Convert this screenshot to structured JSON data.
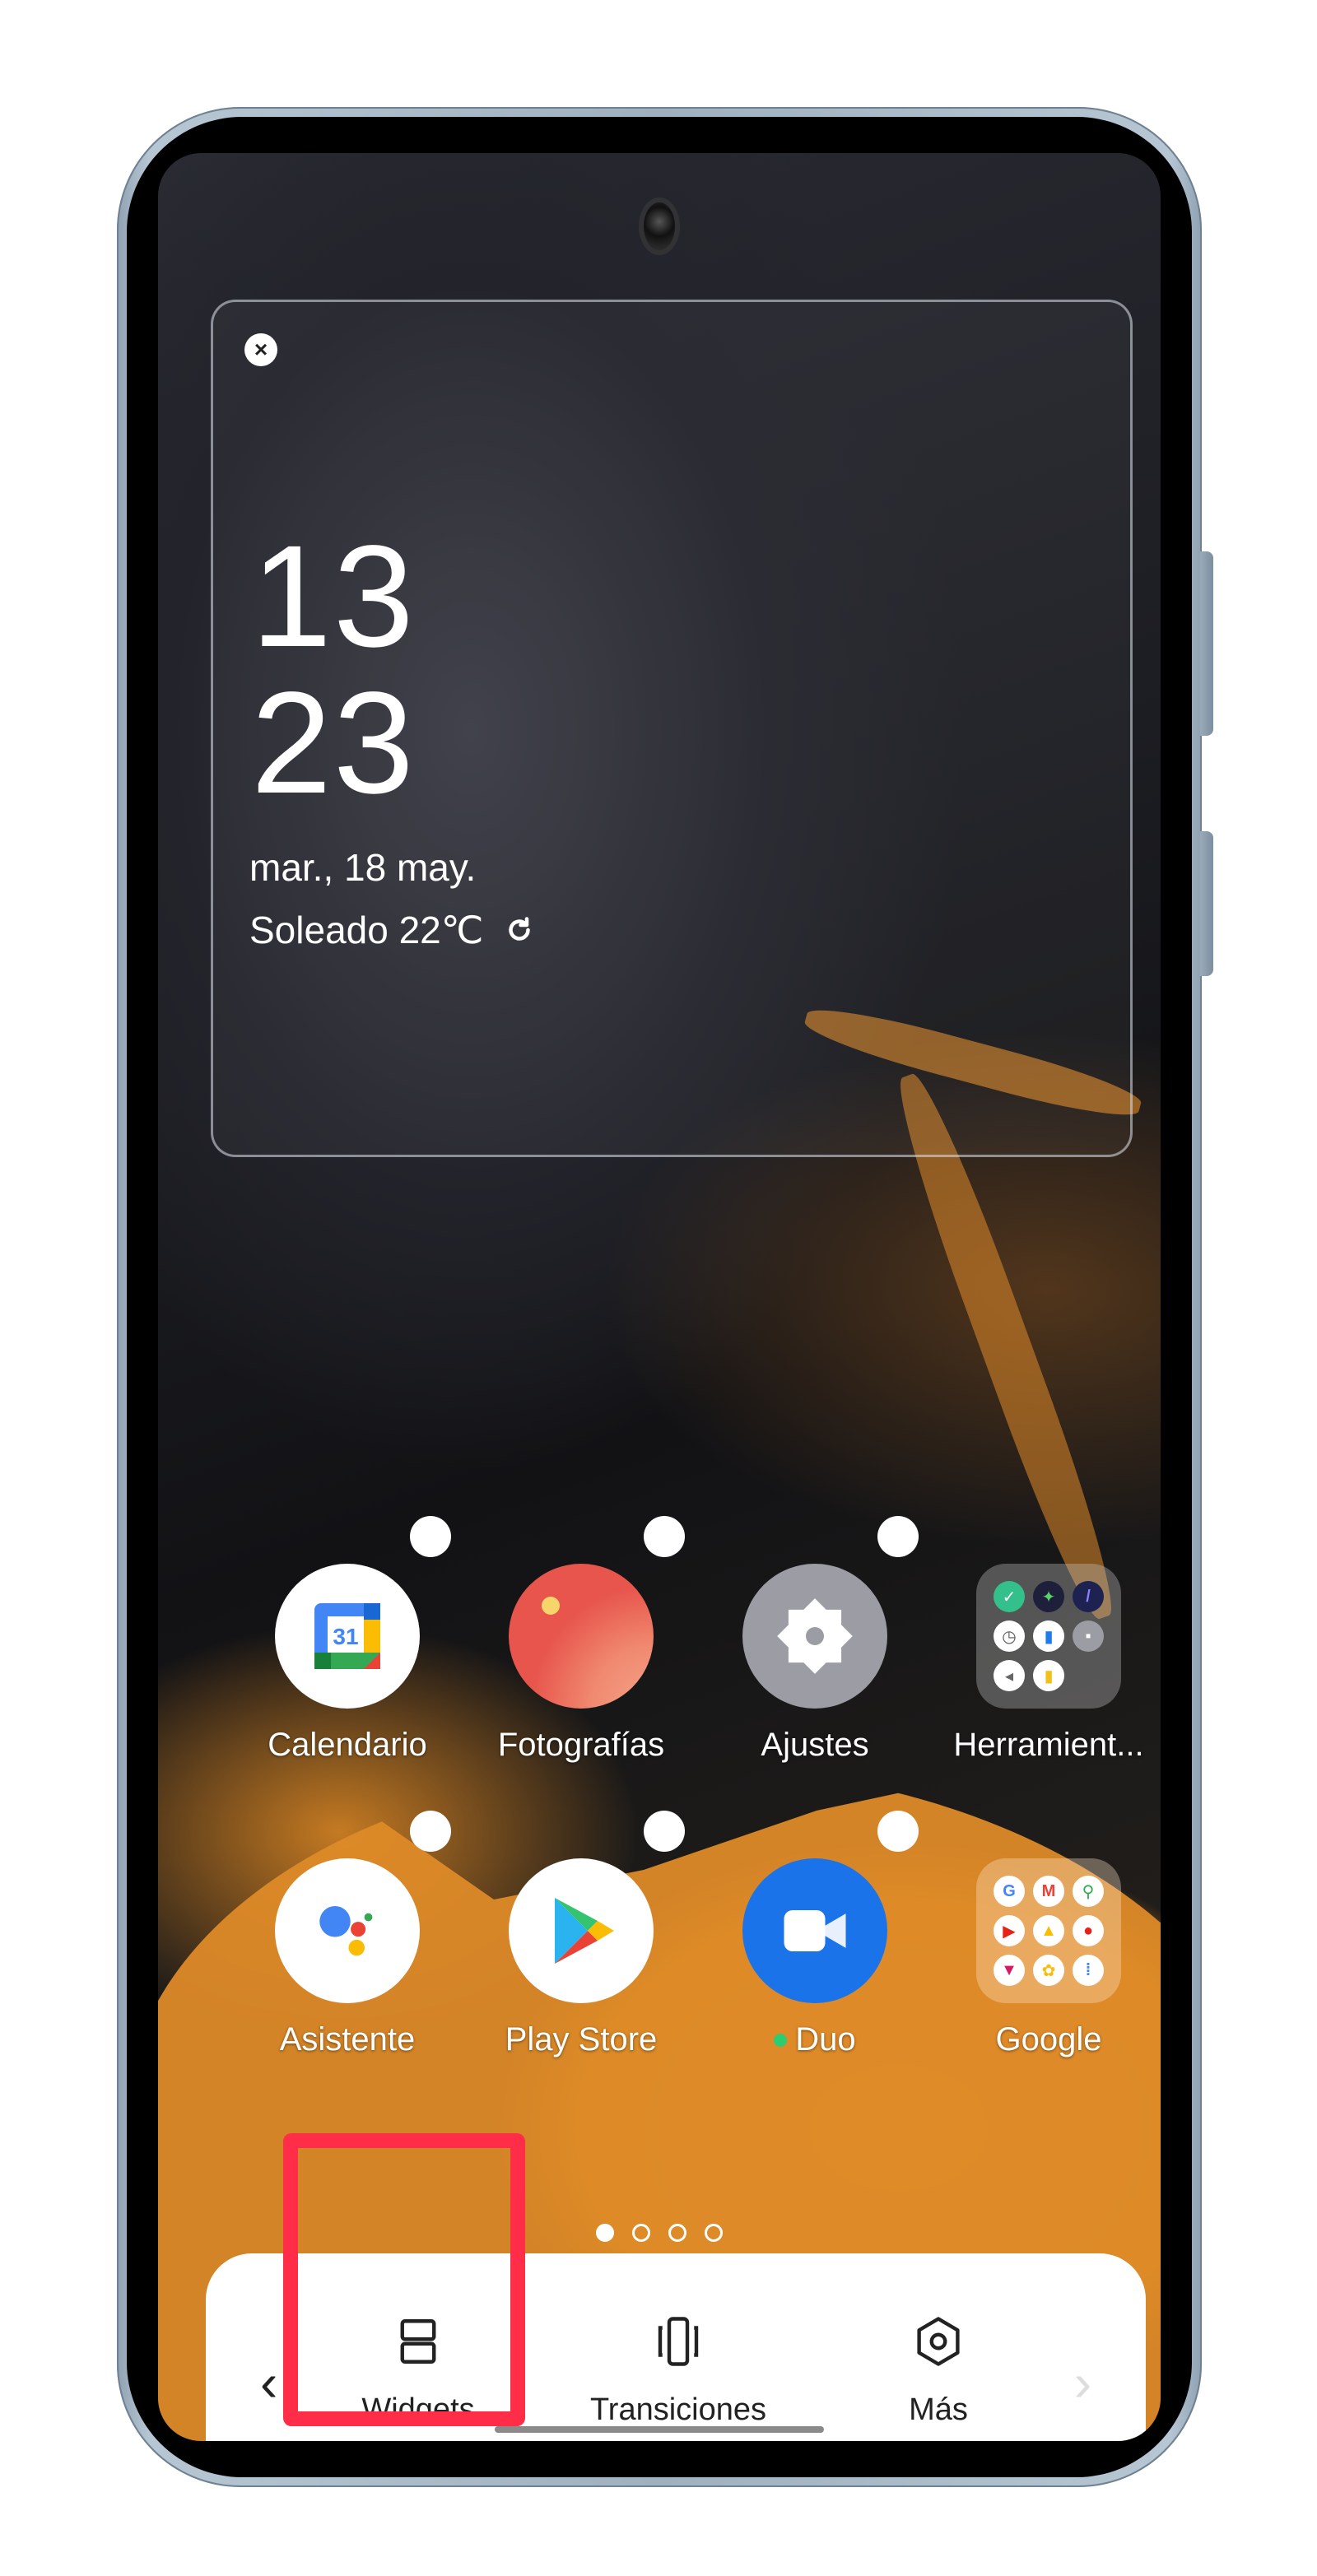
{
  "widget": {
    "close_icon": "close-icon",
    "clock_hours": "13",
    "clock_minutes": "23",
    "date": "mar., 18 may.",
    "weather": "Soleado 22℃",
    "refresh_icon": "refresh-icon"
  },
  "apps": [
    {
      "label": "Calendario",
      "icon": "google-calendar-icon",
      "calendar_day": "31",
      "has_badge": true
    },
    {
      "label": "Fotografías",
      "icon": "photos-icon",
      "has_badge": true
    },
    {
      "label": "Ajustes",
      "icon": "settings-gear-icon",
      "has_badge": true
    },
    {
      "label": "Herramient...",
      "icon": "folder-icon",
      "type": "folder",
      "has_badge": false,
      "folder_apps": [
        "phone-manager-icon",
        "games-icon",
        "compass-icon",
        "clock-icon",
        "file-manager-icon",
        "app-lock-icon",
        "sound-recorder-icon",
        "notes-icon"
      ]
    },
    {
      "label": "Asistente",
      "icon": "google-assistant-icon",
      "has_badge": true
    },
    {
      "label": "Play Store",
      "icon": "play-store-icon",
      "has_badge": true
    },
    {
      "label": "Duo",
      "icon": "duo-video-icon",
      "has_badge": true,
      "new_indicator": true
    },
    {
      "label": "Google",
      "icon": "folder-icon",
      "type": "folder",
      "has_badge": false,
      "folder_apps": [
        "google-icon",
        "gmail-icon",
        "maps-icon",
        "youtube-icon",
        "drive-icon",
        "youtube-music-icon",
        "play-movies-icon",
        "google-photos-icon",
        "podcasts-icon"
      ]
    }
  ],
  "page_indicator": {
    "total": 4,
    "current": 1
  },
  "toolbar": {
    "prev_label": "‹",
    "next_label": "›",
    "items": [
      {
        "label": "Widgets",
        "icon": "widgets-icon",
        "highlighted": true
      },
      {
        "label": "Transiciones",
        "icon": "transitions-icon"
      },
      {
        "label": "Más",
        "icon": "more-settings-icon"
      }
    ]
  },
  "colors": {
    "highlight": "#ff2d48",
    "duo_blue": "#1a73e8",
    "photos_red": "#e8554c",
    "settings_gray": "#9b9ca4",
    "new_app_dot": "#2ecc71"
  }
}
